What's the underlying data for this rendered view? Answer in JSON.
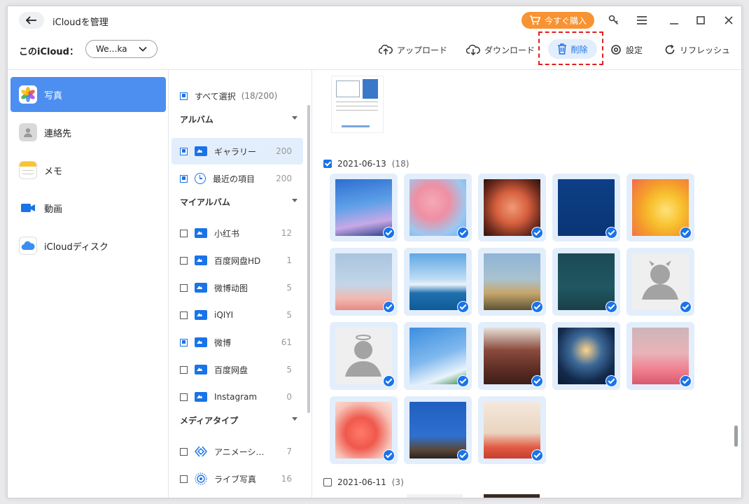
{
  "window": {
    "title": "iCloudを管理"
  },
  "header": {
    "buy_label": "今すぐ購入",
    "account_label": "このiCloud：",
    "account_value": "We…ka"
  },
  "toolbar": {
    "upload": "アップロード",
    "download": "ダウンロード",
    "delete": "削除",
    "settings": "設定",
    "refresh": "リフレッシュ"
  },
  "sidebar": {
    "items": [
      {
        "label": "写真",
        "icon": "photos-icon",
        "active": true
      },
      {
        "label": "連絡先",
        "icon": "contacts-icon"
      },
      {
        "label": "メモ",
        "icon": "notes-icon"
      },
      {
        "label": "動画",
        "icon": "video-icon"
      },
      {
        "label": "iCloudディスク",
        "icon": "icloud-drive-icon"
      }
    ]
  },
  "middle": {
    "select_all": "すべて選択",
    "select_all_count": "(18/200)",
    "sections": {
      "albums": "アルバム",
      "my_albums": "マイアルバム",
      "media_types": "メディアタイプ"
    },
    "albums": [
      {
        "label": "ギャラリー",
        "count": "200",
        "checked": true,
        "selected": true
      },
      {
        "label": "最近の項目",
        "count": "200",
        "checked": true
      }
    ],
    "my_albums": [
      {
        "label": "小红书",
        "count": "12",
        "checked": false
      },
      {
        "label": "百度网盘HD",
        "count": "1",
        "checked": false
      },
      {
        "label": "微博动图",
        "count": "5",
        "checked": false
      },
      {
        "label": "iQIYI",
        "count": "5",
        "checked": false
      },
      {
        "label": "微博",
        "count": "61",
        "checked": true
      },
      {
        "label": "百度网盘",
        "count": "5",
        "checked": false
      },
      {
        "label": "Instagram",
        "count": "0",
        "checked": false
      }
    ],
    "media_types": [
      {
        "label": "アニメーシ…",
        "count": "7",
        "checked": false
      },
      {
        "label": "ライブ写真",
        "count": "16",
        "checked": false
      }
    ]
  },
  "photos": {
    "groups": [
      {
        "date": "2021-06-13",
        "count": "(18)",
        "checked": true
      },
      {
        "date": "2021-06-11",
        "count": "(3)",
        "checked": false
      }
    ],
    "colors": {
      "accent": "#1a73e8",
      "buy": "#f79332",
      "delete_highlight": "#e0201d"
    }
  }
}
